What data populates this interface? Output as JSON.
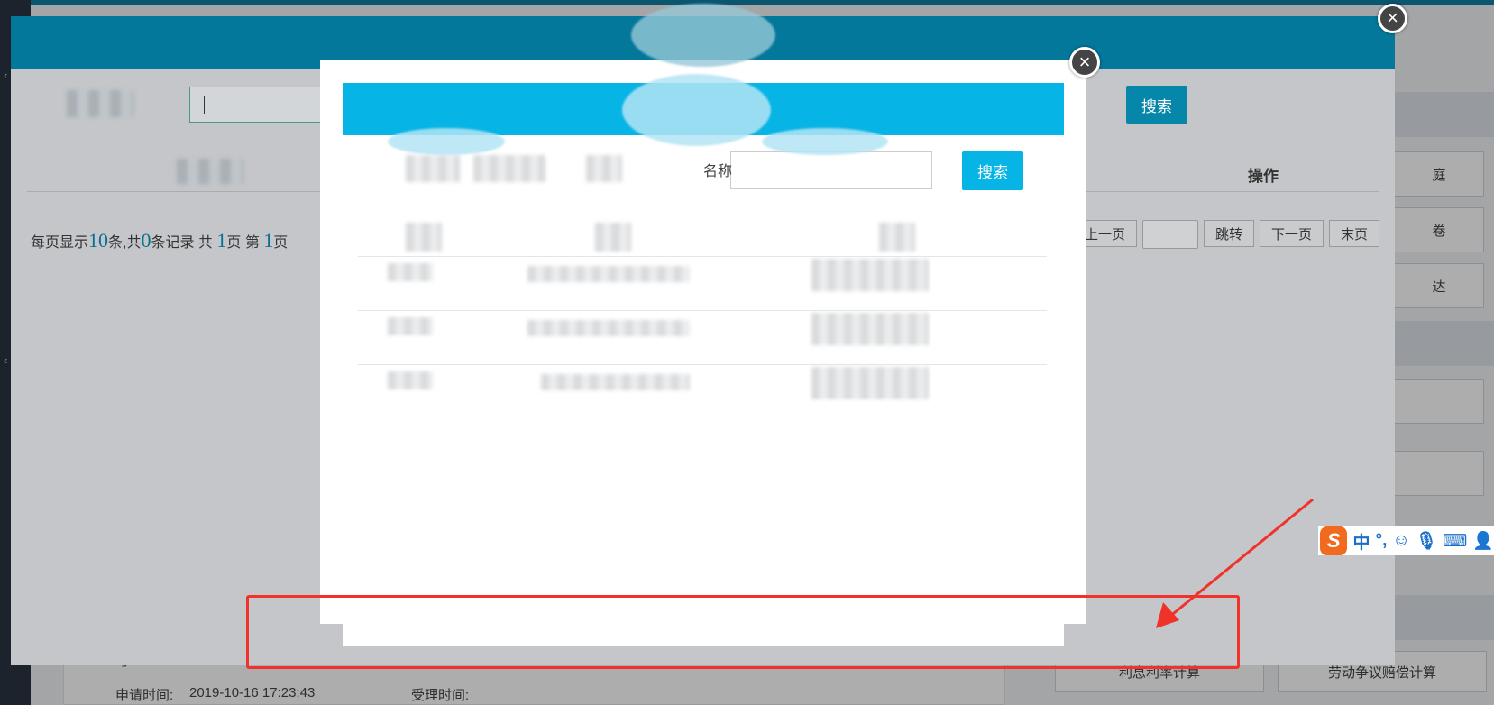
{
  "outer_dialog": {
    "search_button": "搜索",
    "column_operation": "操作",
    "pager": {
      "text_per_page": "每页显示",
      "page_size": "10",
      "text_items_total": "条,共",
      "total_records": "0",
      "text_records_total": "条记录 共",
      "total_pages": "1",
      "text_page_current": "页 第",
      "current_page": "1",
      "text_page_end": "页",
      "prev": "上一页",
      "jump": "跳转",
      "next": "下一页",
      "last": "末页"
    }
  },
  "inner_dialog": {
    "name_label": "名称",
    "search_button": "搜索"
  },
  "background": {
    "apply_time_label": "申请时间:",
    "apply_time_value": "2019-10-16 17:23:43",
    "accept_time_label": "受理时间:",
    "side_items": [
      "庭",
      "卷",
      "达"
    ],
    "calc_interest": "利息利率计算",
    "calc_labor": "劳动争议赔偿计算",
    "partial_text": "与..."
  },
  "ime_toolbar": {
    "logo": "S",
    "mode": "中",
    "punct": "°,"
  },
  "icons": {
    "close": "close-icon",
    "ime_emoji": "smile-icon",
    "ime_voice": "microphone-icon",
    "ime_keyboard": "keyboard-icon",
    "ime_user": "user-icon"
  },
  "colors": {
    "outer_header": "#04789b",
    "inner_header": "#06b4e5",
    "search_button": "#06b4e5",
    "annotation": "#f0322b"
  }
}
